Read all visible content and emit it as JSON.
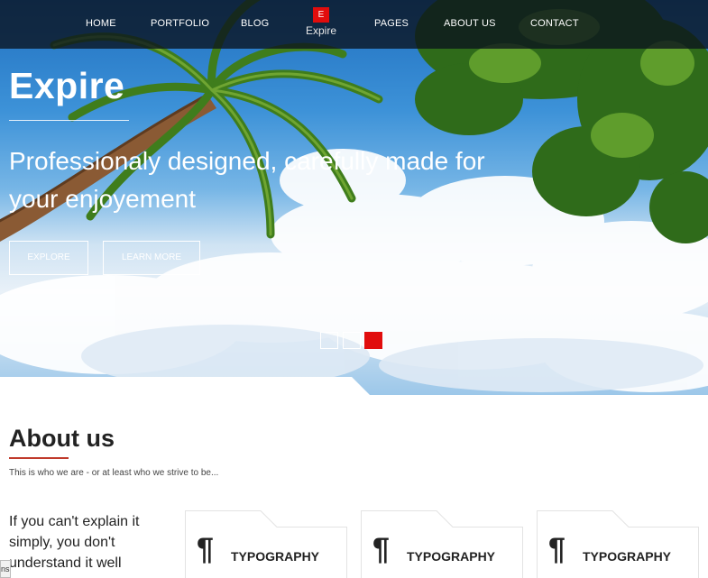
{
  "nav": {
    "items": [
      {
        "label": "HOME",
        "id": "home"
      },
      {
        "label": "PORTFOLIO",
        "id": "portfolio"
      },
      {
        "label": "BLOG",
        "id": "blog"
      },
      {
        "label": "PAGES",
        "id": "pages"
      },
      {
        "label": "ABOUT US",
        "id": "about-us"
      },
      {
        "label": "CONTACT",
        "id": "contact"
      }
    ],
    "logo": {
      "mark": "E",
      "text": "Expire"
    }
  },
  "hero": {
    "title": "Expire",
    "subtitle": "Professionaly designed, carefully made for your enjoyement",
    "buttons": [
      {
        "label": "EXPLORE"
      },
      {
        "label": "LEARN MORE"
      }
    ],
    "slider": {
      "count": 3,
      "active_index": 2
    }
  },
  "about": {
    "title": "About us",
    "tagline": "This is who we are - or at least who we strive to be...",
    "quote": "If you can't explain it simply, you don't understand it well",
    "cards": [
      {
        "icon": "¶",
        "label": "TYPOGRAPHY"
      },
      {
        "icon": "¶",
        "label": "TYPOGRAPHY"
      },
      {
        "icon": "¶",
        "label": "TYPOGRAPHY"
      }
    ]
  },
  "edge_tab": {
    "text": "ns"
  },
  "colors": {
    "accent": "#e10d0d",
    "nav_bg": "#0a121e",
    "title_underline": "#c0392b"
  }
}
